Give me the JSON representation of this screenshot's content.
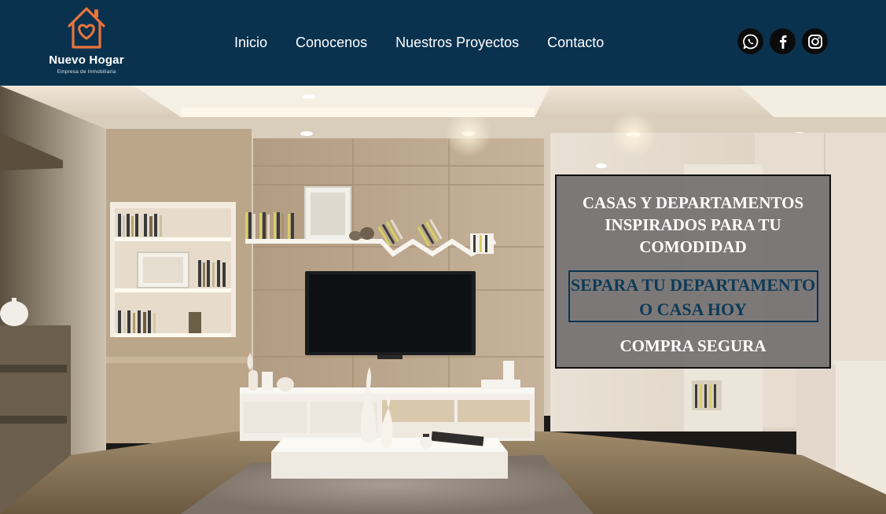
{
  "brand": {
    "name": "Nuevo Hogar",
    "tagline": "Empresa de Inmobiliaria",
    "icon": "house-heart-icon",
    "accent_color": "#e9743d"
  },
  "header": {
    "background": "#0a324f"
  },
  "nav": {
    "items": [
      {
        "label": "Inicio"
      },
      {
        "label": "Conocenos"
      },
      {
        "label": "Nuestros Proyectos"
      },
      {
        "label": "Contacto"
      }
    ]
  },
  "social": [
    {
      "icon": "whatsapp-icon"
    },
    {
      "icon": "facebook-icon"
    },
    {
      "icon": "instagram-icon"
    }
  ],
  "hero": {
    "image": "living-room-tv-wall-photo",
    "promo": {
      "title": "CASAS Y DEPARTAMENTOS INSPIRADOS PARA TU COMODIDAD",
      "cta": "SEPARA TU DEPARTAMENTO O CASA HOY",
      "subtitle": "COMPRA SEGURA"
    }
  }
}
